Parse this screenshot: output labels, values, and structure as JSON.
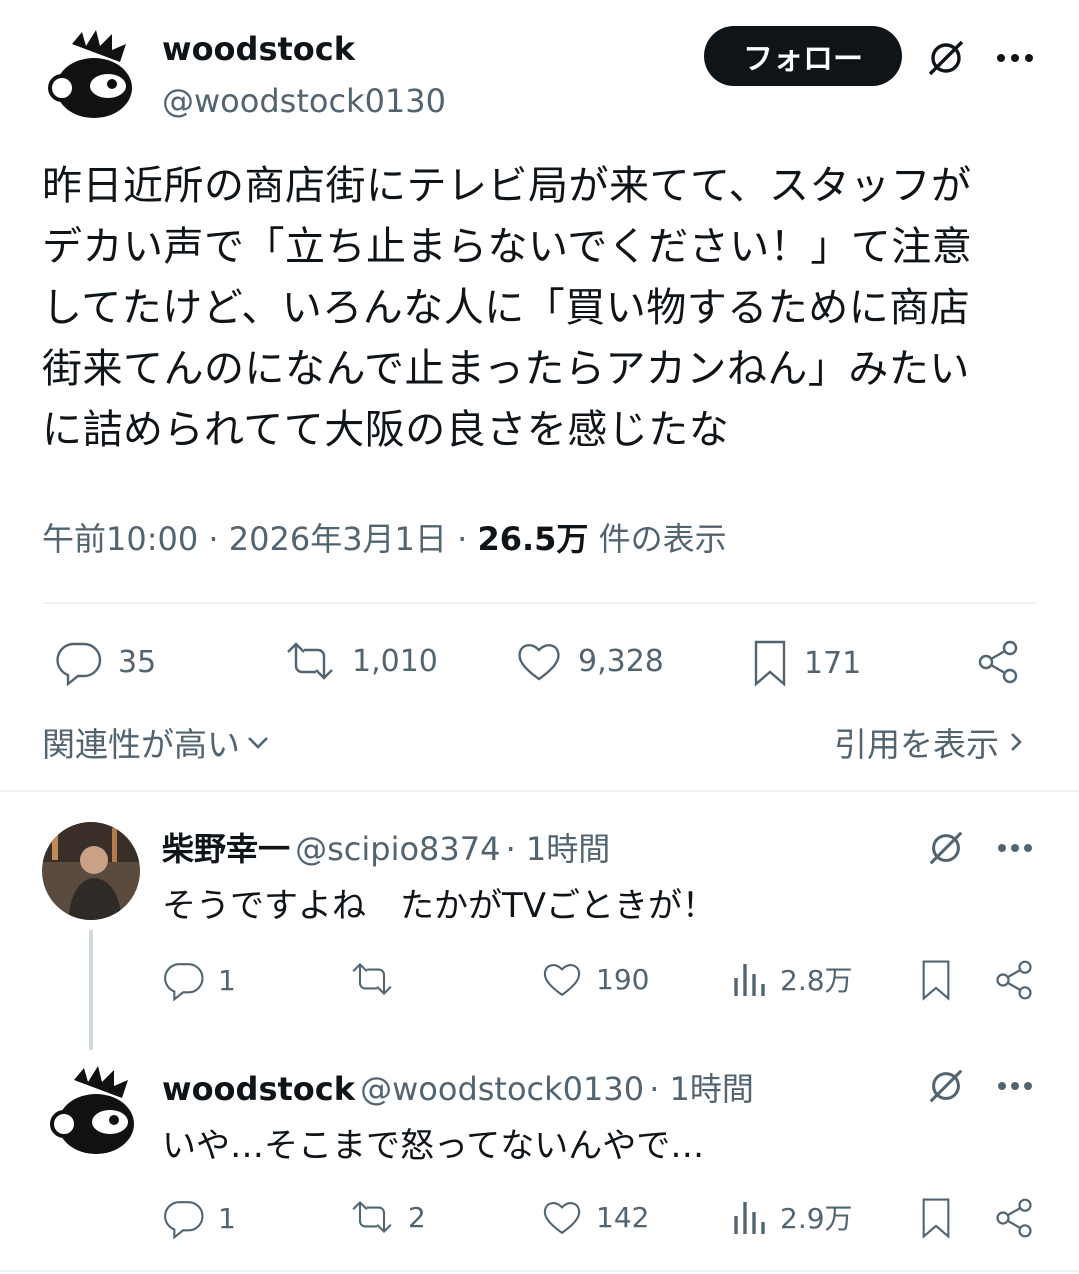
{
  "main": {
    "author_name": "woodstock",
    "author_handle": "@woodstock0130",
    "follow_label": "フォロー",
    "text_lines": [
      "昨日近所の商店街にテレビ局が来てて、スタッフが",
      "デカい声で「立ち止まらないでください！」て注意",
      "してたけど、いろんな人に「買い物するために商店",
      "街来てんのになんで止まったらアカンねん」みたい",
      "に詰められてて大阪の良さを感じたな"
    ],
    "time": "午前10:00",
    "date": "2026年3月1日",
    "views_count": "26.5万",
    "views_label": "件の表示",
    "replies": "35",
    "reposts": "1,010",
    "likes": "9,328",
    "bookmarks": "171"
  },
  "sort_label": "関連性が高い",
  "quotes_label": "引用を表示",
  "replies": [
    {
      "name": "柴野幸一",
      "handle": "@scipio8374",
      "time": "· 1時間",
      "text": "そうですよね　たかがTVごときが！",
      "replies": "1",
      "reposts": "",
      "likes": "190",
      "views": "2.8万"
    },
    {
      "name": "woodstock",
      "handle": "@woodstock0130",
      "time": "· 1時間",
      "text": "いや…そこまで怒ってないんやで…",
      "replies": "1",
      "reposts": "2",
      "likes": "142",
      "views": "2.9万"
    }
  ]
}
